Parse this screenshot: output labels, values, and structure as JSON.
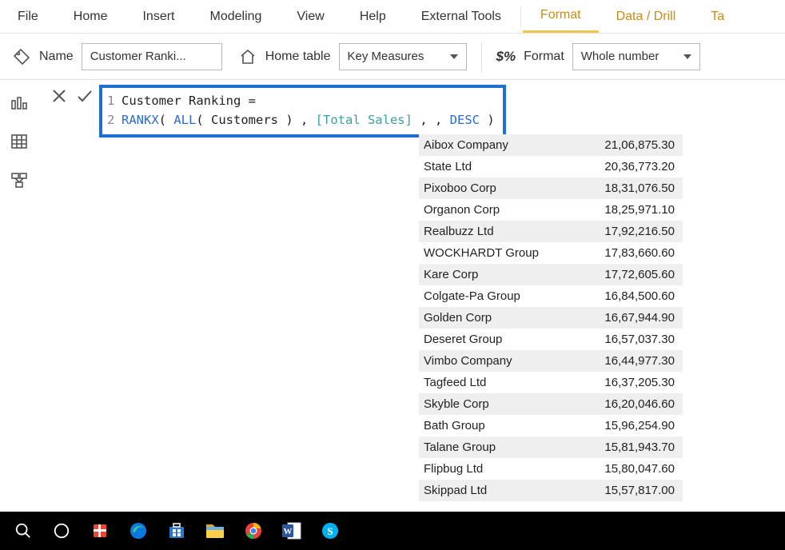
{
  "ribbon": {
    "tabs": [
      "File",
      "Home",
      "Insert",
      "Modeling",
      "View",
      "Help",
      "External Tools",
      "Format",
      "Data / Drill",
      "Ta"
    ],
    "active_index": 7
  },
  "subribbon": {
    "name_label": "Name",
    "name_value": "Customer Ranki...",
    "home_table_label": "Home table",
    "home_table_value": "Key Measures",
    "format_label": "Format",
    "format_value": "Whole number"
  },
  "formula": {
    "lines": [
      {
        "n": "1",
        "text_plain": "Customer Ranking ="
      },
      {
        "n": "2",
        "text_plain": "RANKX( ALL( Customers ) , [Total Sales] , , DESC )"
      }
    ],
    "tokens_line2": [
      {
        "t": "RANKX",
        "c": "tok-kw"
      },
      {
        "t": "( ",
        "c": "tok-plain"
      },
      {
        "t": "ALL",
        "c": "tok-kw"
      },
      {
        "t": "( Customers ) , ",
        "c": "tok-plain"
      },
      {
        "t": "[Total Sales]",
        "c": "tok-br"
      },
      {
        "t": " , , ",
        "c": "tok-plain"
      },
      {
        "t": "DESC",
        "c": "tok-kw"
      },
      {
        "t": " )",
        "c": "tok-plain"
      }
    ]
  },
  "table": {
    "rows": [
      {
        "name": "Aibox Company",
        "value": "21,06,875.30"
      },
      {
        "name": "State Ltd",
        "value": "20,36,773.20"
      },
      {
        "name": "Pixoboo Corp",
        "value": "18,31,076.50"
      },
      {
        "name": "Organon Corp",
        "value": "18,25,971.10"
      },
      {
        "name": "Realbuzz Ltd",
        "value": "17,92,216.50"
      },
      {
        "name": "WOCKHARDT Group",
        "value": "17,83,660.60"
      },
      {
        "name": "Kare Corp",
        "value": "17,72,605.60"
      },
      {
        "name": "Colgate-Pa Group",
        "value": "16,84,500.60"
      },
      {
        "name": "Golden Corp",
        "value": "16,67,944.90"
      },
      {
        "name": "Deseret Group",
        "value": "16,57,037.30"
      },
      {
        "name": "Vimbo Company",
        "value": "16,44,977.30"
      },
      {
        "name": "Tagfeed Ltd",
        "value": "16,37,205.30"
      },
      {
        "name": "Skyble Corp",
        "value": "16,20,046.60"
      },
      {
        "name": "Bath Group",
        "value": "15,96,254.90"
      },
      {
        "name": "Talane Group",
        "value": "15,81,943.70"
      },
      {
        "name": "Flipbug Ltd",
        "value": "15,80,047.60"
      },
      {
        "name": "Skippad Ltd",
        "value": "15,57,817.00"
      }
    ]
  },
  "taskbar_icons": [
    "search",
    "cortana",
    "gift",
    "edge",
    "store",
    "explorer",
    "chrome",
    "word",
    "skype"
  ]
}
